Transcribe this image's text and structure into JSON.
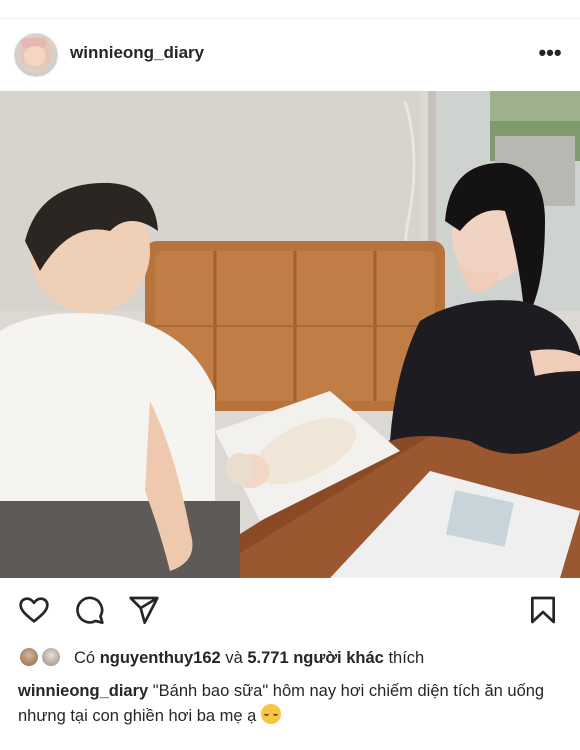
{
  "post": {
    "username": "winnieong_diary",
    "more_label": "•••",
    "photo_alt": "winnieong_diary post photo",
    "icons": {
      "avatar": "avatar",
      "more": "more-options-icon",
      "like": "heart-icon",
      "comment": "comment-icon",
      "share": "send-icon",
      "save": "bookmark-icon"
    }
  },
  "likes": {
    "prefix": "Có",
    "liker": "nguyenthuy162",
    "conj": "và",
    "others": "5.771 người khác",
    "suffix": "thích"
  },
  "caption": {
    "username": "winnieong_diary",
    "text": "\"Bánh bao sữa\" hôm nay hơi chiếm diện tích ăn uống nhưng tại con ghiền hơi ba mẹ ạ",
    "emoji": "smiling-face-emoji"
  },
  "colors": {
    "text": "#262626",
    "divider": "#efefef"
  }
}
